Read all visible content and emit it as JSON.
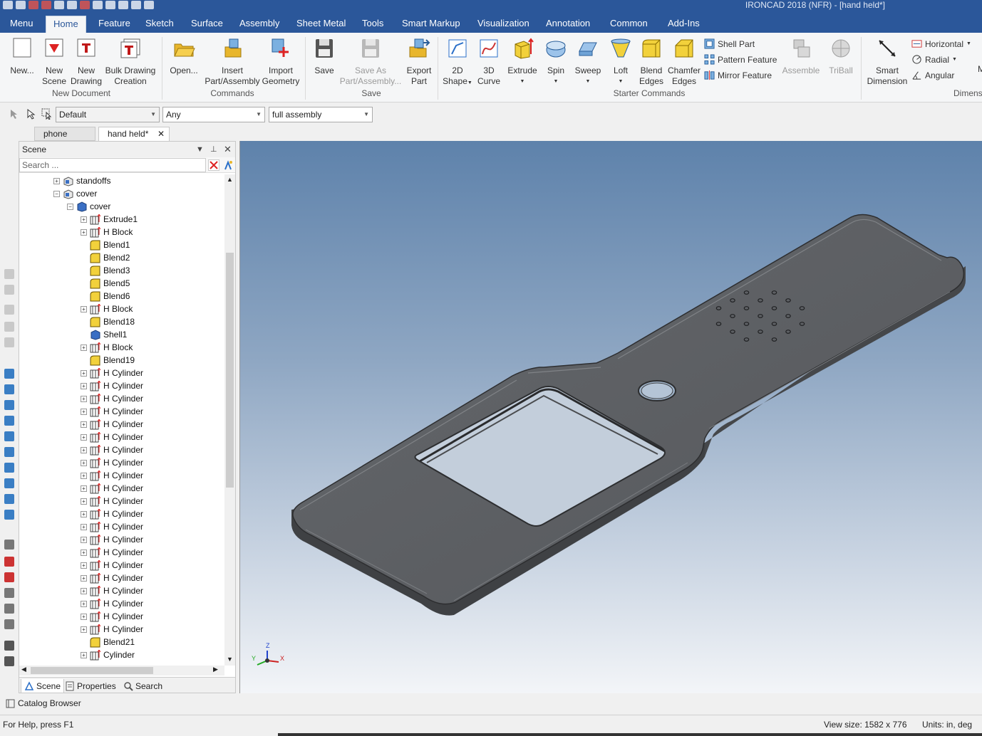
{
  "window": {
    "title": "IRONCAD 2018 (NFR) - [hand held*]"
  },
  "menu_tabs": [
    "Menu",
    "Home",
    "Feature",
    "Sketch",
    "Surface",
    "Assembly",
    "Sheet Metal",
    "Tools",
    "Smart Markup",
    "Visualization",
    "Annotation",
    "Common",
    "Add-Ins"
  ],
  "active_tab": "Home",
  "ribbon": {
    "new": "New...",
    "new_scene": [
      "New",
      "Scene"
    ],
    "new_drawing": [
      "New",
      "Drawing"
    ],
    "bulk_drawing": [
      "Bulk Drawing",
      "Creation"
    ],
    "group_new_document": "New Document",
    "open": "Open...",
    "insert": [
      "Insert",
      "Part/Assembly"
    ],
    "import": [
      "Import",
      "Geometry"
    ],
    "group_commands": "Commands",
    "save": "Save",
    "save_as": [
      "Save As",
      "Part/Assembly..."
    ],
    "export": [
      "Export",
      "Part"
    ],
    "group_save": "Save",
    "shape2d": [
      "2D",
      "Shape"
    ],
    "curve3d": [
      "3D",
      "Curve"
    ],
    "extrude": "Extrude",
    "spin": "Spin",
    "sweep": "Sweep",
    "loft": "Loft",
    "blend": [
      "Blend",
      "Edges"
    ],
    "chamfer": [
      "Chamfer",
      "Edges"
    ],
    "shell_part": "Shell Part",
    "pattern_feature": "Pattern Feature",
    "mirror_feature": "Mirror Feature",
    "group_starter": "Starter Commands",
    "assemble": "Assemble",
    "triball": "TriBall",
    "smart_dimension": [
      "Smart",
      "Dimension"
    ],
    "horizontal": "Horizontal",
    "radial": "Radial",
    "angular": "Angular",
    "group_dimension": "Dimens",
    "cut_letter": "M"
  },
  "toolbar": {
    "style_combo": "Default",
    "filter_combo": "Any",
    "scope_combo": "full assembly"
  },
  "doc_tabs": [
    {
      "label": "phone box*"
    },
    {
      "label": "hand held*"
    }
  ],
  "scene_panel": {
    "title": "Scene",
    "search_placeholder": "Search ..."
  },
  "tree": [
    {
      "label": "standoffs",
      "level": 0,
      "exp": "+",
      "icon": "assembly-icon"
    },
    {
      "label": "cover",
      "level": 0,
      "exp": "-",
      "icon": "assembly-icon"
    },
    {
      "label": "cover",
      "level": 1,
      "exp": "-",
      "icon": "part-icon"
    },
    {
      "label": "Extrude1",
      "level": 2,
      "exp": "+",
      "icon": "extrude-icon"
    },
    {
      "label": "H Block",
      "level": 2,
      "exp": "+",
      "icon": "extrude-icon"
    },
    {
      "label": "Blend1",
      "level": 2,
      "exp": "",
      "icon": "blend-icon"
    },
    {
      "label": "Blend2",
      "level": 2,
      "exp": "",
      "icon": "blend-icon"
    },
    {
      "label": "Blend3",
      "level": 2,
      "exp": "",
      "icon": "blend-icon"
    },
    {
      "label": "Blend5",
      "level": 2,
      "exp": "",
      "icon": "blend-icon"
    },
    {
      "label": "Blend6",
      "level": 2,
      "exp": "",
      "icon": "blend-icon"
    },
    {
      "label": "H Block",
      "level": 2,
      "exp": "+",
      "icon": "extrude-icon"
    },
    {
      "label": "Blend18",
      "level": 2,
      "exp": "",
      "icon": "blend-icon"
    },
    {
      "label": "Shell1",
      "level": 2,
      "exp": "",
      "icon": "shell-icon"
    },
    {
      "label": "H Block",
      "level": 2,
      "exp": "+",
      "icon": "extrude-icon"
    },
    {
      "label": "Blend19",
      "level": 2,
      "exp": "",
      "icon": "blend-icon"
    },
    {
      "label": "H Cylinder",
      "level": 2,
      "exp": "+",
      "icon": "extrude-icon"
    },
    {
      "label": "H Cylinder",
      "level": 2,
      "exp": "+",
      "icon": "extrude-icon"
    },
    {
      "label": "H Cylinder",
      "level": 2,
      "exp": "+",
      "icon": "extrude-icon"
    },
    {
      "label": "H Cylinder",
      "level": 2,
      "exp": "+",
      "icon": "extrude-icon"
    },
    {
      "label": "H Cylinder",
      "level": 2,
      "exp": "+",
      "icon": "extrude-icon"
    },
    {
      "label": "H Cylinder",
      "level": 2,
      "exp": "+",
      "icon": "extrude-icon"
    },
    {
      "label": "H Cylinder",
      "level": 2,
      "exp": "+",
      "icon": "extrude-icon"
    },
    {
      "label": "H Cylinder",
      "level": 2,
      "exp": "+",
      "icon": "extrude-icon"
    },
    {
      "label": "H Cylinder",
      "level": 2,
      "exp": "+",
      "icon": "extrude-icon"
    },
    {
      "label": "H Cylinder",
      "level": 2,
      "exp": "+",
      "icon": "extrude-icon"
    },
    {
      "label": "H Cylinder",
      "level": 2,
      "exp": "+",
      "icon": "extrude-icon"
    },
    {
      "label": "H Cylinder",
      "level": 2,
      "exp": "+",
      "icon": "extrude-icon"
    },
    {
      "label": "H Cylinder",
      "level": 2,
      "exp": "+",
      "icon": "extrude-icon"
    },
    {
      "label": "H Cylinder",
      "level": 2,
      "exp": "+",
      "icon": "extrude-icon"
    },
    {
      "label": "H Cylinder",
      "level": 2,
      "exp": "+",
      "icon": "extrude-icon"
    },
    {
      "label": "H Cylinder",
      "level": 2,
      "exp": "+",
      "icon": "extrude-icon"
    },
    {
      "label": "H Cylinder",
      "level": 2,
      "exp": "+",
      "icon": "extrude-icon"
    },
    {
      "label": "H Cylinder",
      "level": 2,
      "exp": "+",
      "icon": "extrude-icon"
    },
    {
      "label": "H Cylinder",
      "level": 2,
      "exp": "+",
      "icon": "extrude-icon"
    },
    {
      "label": "H Cylinder",
      "level": 2,
      "exp": "+",
      "icon": "extrude-icon"
    },
    {
      "label": "H Cylinder",
      "level": 2,
      "exp": "+",
      "icon": "extrude-icon"
    },
    {
      "label": "Blend21",
      "level": 2,
      "exp": "",
      "icon": "blend-icon"
    },
    {
      "label": "Cylinder",
      "level": 2,
      "exp": "+",
      "icon": "extrude-icon"
    }
  ],
  "scene_tabs": [
    "Scene",
    "Properties",
    "Search"
  ],
  "triad_labels": {
    "z": "Z",
    "x": "X",
    "y": "Y"
  },
  "catalog": "Catalog Browser",
  "status": {
    "help": "For Help, press F1",
    "view_size": "View size: 1582 x  776",
    "units": "Units: in, deg"
  },
  "colors": {
    "title_bar": "#2b579a",
    "ribbon_bg": "#f5f6f7",
    "model": "#5a5c5f",
    "viewport_top": "#5e82ab",
    "viewport_bottom": "#f3f5f8"
  }
}
